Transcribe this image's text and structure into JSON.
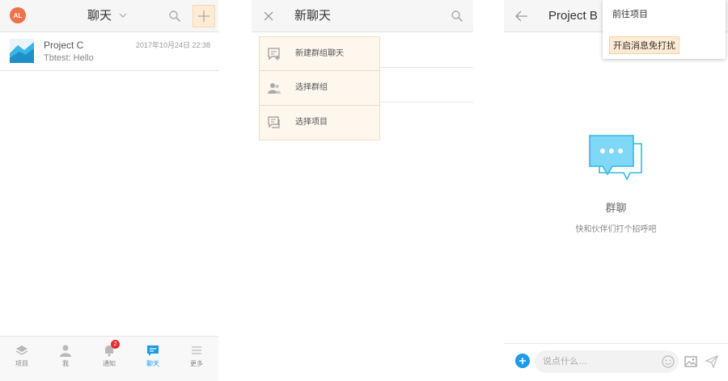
{
  "screen1": {
    "avatar_initials": "AL",
    "title": "聊天",
    "chats": [
      {
        "name": "Project C",
        "last_message": "Tbtest: Hello",
        "time": "2017年10月24日 22:38"
      }
    ],
    "tabs": [
      {
        "label": "项目",
        "icon": "layers-icon",
        "active": false
      },
      {
        "label": "我",
        "icon": "person-icon",
        "active": false
      },
      {
        "label": "通知",
        "icon": "bell-icon",
        "active": false,
        "badge": "2"
      },
      {
        "label": "聊天",
        "icon": "chat-icon",
        "active": true
      },
      {
        "label": "更多",
        "icon": "menu-icon",
        "active": false
      }
    ]
  },
  "screen2": {
    "title": "新聊天",
    "menu": [
      {
        "label": "新建群组聊天",
        "icon": "new-group-chat-icon"
      },
      {
        "label": "选择群组",
        "icon": "group-icon"
      },
      {
        "label": "选择项目",
        "icon": "project-icon"
      }
    ]
  },
  "screen3": {
    "title": "Project B",
    "dropdown": [
      {
        "label": "前往项目"
      },
      {
        "label": "开启消息免打扰",
        "highlighted": true
      }
    ],
    "empty_title": "群聊",
    "empty_subtitle": "快和伙伴们打个招呼吧",
    "input_placeholder": "说点什么…"
  },
  "colors": {
    "accent": "#1d9be8",
    "avatar": "#f0714a",
    "highlight": "#fdebd3",
    "badge": "#e52d2d"
  }
}
